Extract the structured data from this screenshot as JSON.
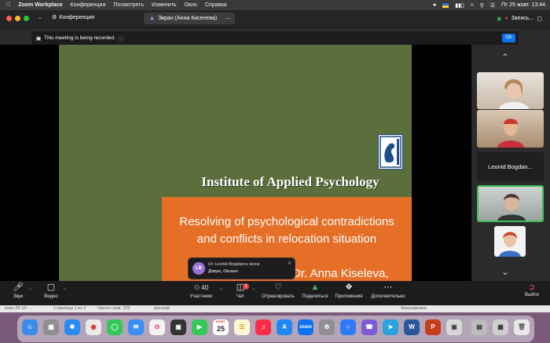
{
  "menubar": {
    "items": [
      "Zoom Workplace",
      "Конференция",
      "Посмотреть",
      "Изменить",
      "Окно",
      "Справка"
    ],
    "datetime": "Пт 25 жовт.  13:44"
  },
  "titlebar": {
    "conference_label": "Конференция",
    "screen_share_label": "Экран (Анна Киселева)",
    "recording_label": "Запись..."
  },
  "banner": {
    "message": "This meeting is being recorded.",
    "ok_label": "OK"
  },
  "slide": {
    "title": "Institute of Applied Psychology",
    "subtitle_line1": "Resolving of psychological contradictions",
    "subtitle_line2": "and conflicts in relocation situation",
    "author": "Dr. Anna Kiseleva,"
  },
  "chat_toast": {
    "avatar_initials": "LB",
    "from": "От Leonid Bogdanov всем",
    "message": "Дякую, Оксано"
  },
  "participants_panel": {
    "name_tile": "Leonid Bogdan..."
  },
  "toolbar": {
    "audio": "Звук",
    "video": "Видео",
    "participants": "Участники",
    "participants_count": "40",
    "chat": "Чат",
    "chat_badge": "5",
    "react": "Отреагировать",
    "share": "Поделиться",
    "apps": "Приложения",
    "more": "Дополнительно",
    "leave": "Выйти"
  },
  "statusbar": {
    "doc_name": "клас-25-10-...",
    "pages": "Страница 1 из 2",
    "words": "Число слов: 223",
    "language": "русский",
    "focus": "Фокусировка"
  },
  "dock": {
    "calendar_month": "ЖОВТ.",
    "calendar_day": "25",
    "zoom_label": "zoom"
  },
  "colors": {
    "slide_green": "#5b6e3c",
    "slide_orange": "#e56f27",
    "zoom_blue": "#0e72ed",
    "active_speaker": "#3fbf5a"
  }
}
